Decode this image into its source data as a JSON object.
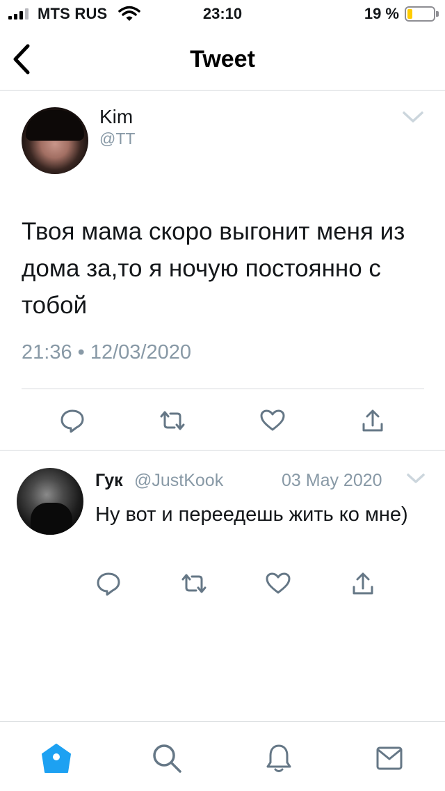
{
  "status_bar": {
    "carrier": "MTS RUS",
    "time": "23:10",
    "battery_percent": "19 %",
    "battery_level": 0.19,
    "battery_color": "#ffcc00"
  },
  "nav": {
    "title": "Tweet",
    "back_icon": "chevron-left-icon"
  },
  "tweet": {
    "author_name": "Kim",
    "author_handle": "@TT",
    "text": "Твоя мама скоро выгонит меня из дома за,то я ночую постоянно с тобой",
    "timestamp": "21:36 • 12/03/2020",
    "actions": [
      "reply-icon",
      "retweet-icon",
      "like-icon",
      "share-icon"
    ]
  },
  "reply": {
    "author_name": "Гук",
    "author_handle": "@JustKook",
    "date": "03 May 2020",
    "text": "Ну вот и переедешь жить ко мне)",
    "actions": [
      "reply-icon",
      "retweet-icon",
      "like-icon",
      "share-icon"
    ]
  },
  "tab_bar": {
    "items": [
      "home-icon",
      "search-icon",
      "notifications-icon",
      "messages-icon"
    ],
    "active": "home-icon",
    "active_color": "#1da1f2"
  },
  "colors": {
    "secondary_text": "#8899a6",
    "icon": "#657786",
    "divider": "#d6d9dc"
  }
}
